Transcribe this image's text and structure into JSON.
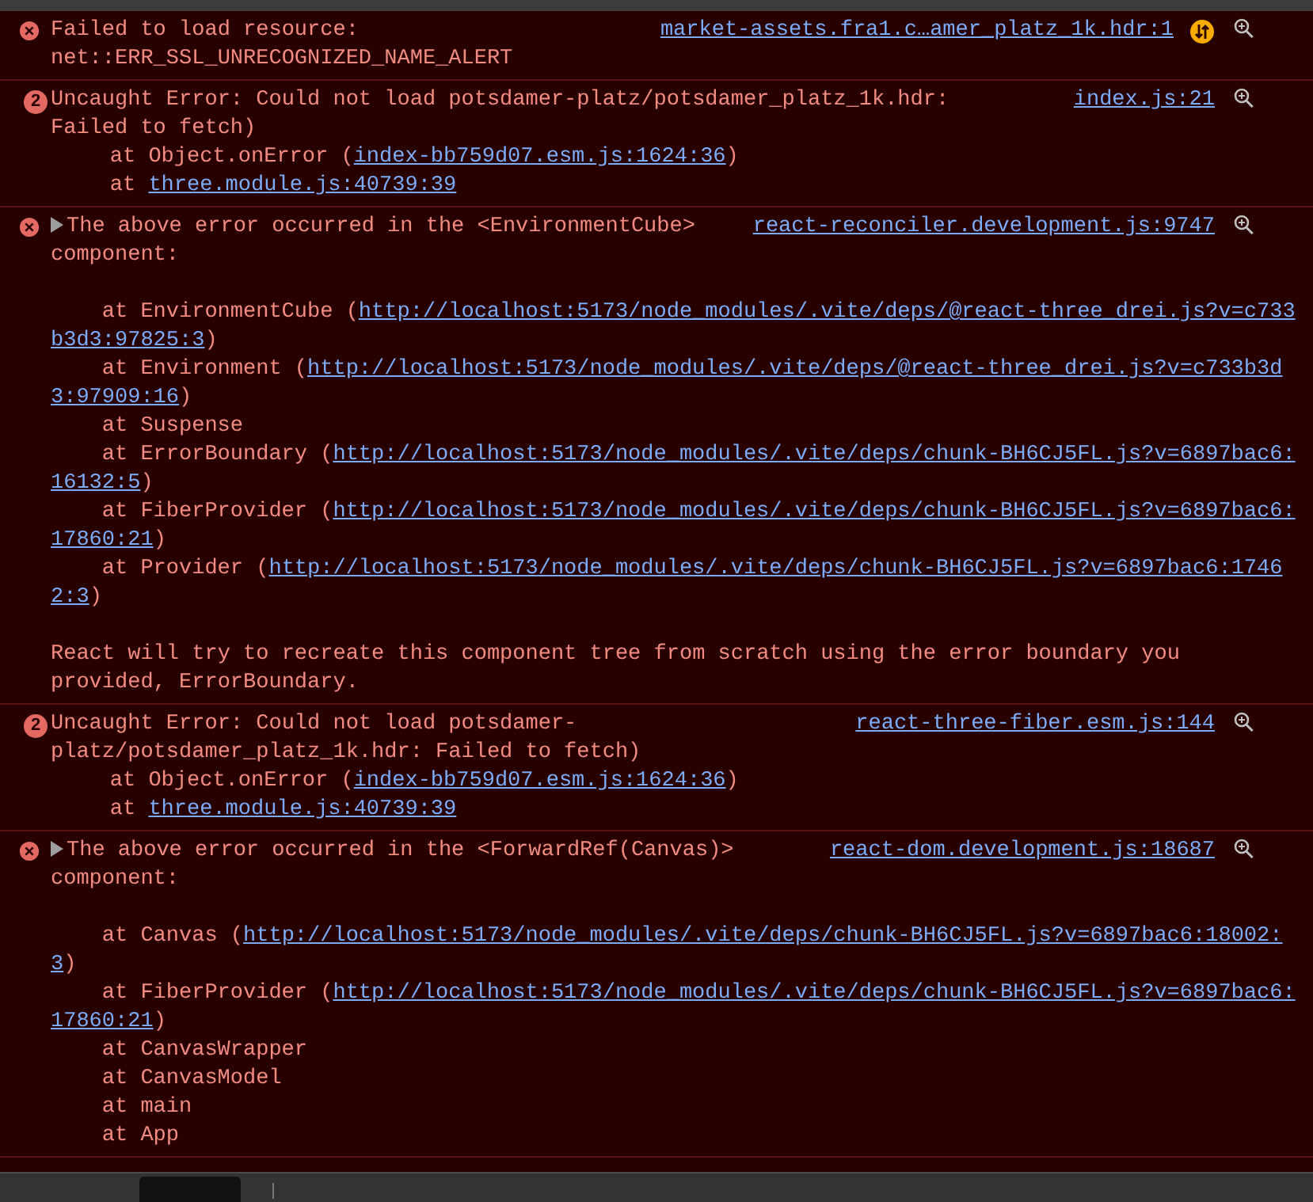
{
  "messages": [
    {
      "icon": {
        "kind": "error"
      },
      "override_icon": true,
      "head": [
        "Failed to load resource:",
        "net::ERR_SSL_UNRECOGNIZED_NAME_ALERT"
      ],
      "source": "market-assets.fra1.c…amer_platz_1k.hdr:1"
    },
    {
      "icon": {
        "kind": "count",
        "count": "2"
      },
      "override_icon": false,
      "head": [
        "Uncaught Error: Could not load potsdamer-platz/potsdamer_platz_1k.hdr:",
        "Failed to fetch)"
      ],
      "source": "index.js:21",
      "body": [
        {
          "kind": "frame",
          "text": "at Object.onError (",
          "url": "index-bb759d07.esm.js:1624:36",
          "suffix": ")"
        },
        {
          "kind": "frame",
          "text": "at ",
          "url": "three.module.js:40739:39"
        }
      ]
    },
    {
      "icon": {
        "kind": "error"
      },
      "override_icon": false,
      "expander": {
        "expanded": false
      },
      "head": [
        "The above error occurred in the <EnvironmentCube>",
        "component:"
      ],
      "source": "react-reconciler.development.js:9747",
      "body": [
        {
          "kind": "gap"
        },
        {
          "kind": "frame",
          "text": "at EnvironmentCube (",
          "url": "http://localhost:5173/node_modules/.vite/deps/@react-three_drei.js?v=c733b3d3:97825:3",
          "suffix": ")"
        },
        {
          "kind": "frame",
          "text": "at Environment (",
          "url": "http://localhost:5173/node_modules/.vite/deps/@react-three_drei.js?v=c733b3d3:97909:16",
          "suffix": ")"
        },
        {
          "kind": "frame",
          "text": "at Suspense"
        },
        {
          "kind": "frame",
          "text": "at ErrorBoundary (",
          "url": "http://localhost:5173/node_modules/.vite/deps/chunk-BH6CJ5FL.js?v=6897bac6:16132:5",
          "suffix": ")"
        },
        {
          "kind": "frame",
          "text": "at FiberProvider (",
          "url": "http://localhost:5173/node_modules/.vite/deps/chunk-BH6CJ5FL.js?v=6897bac6:17860:21",
          "suffix": ")"
        },
        {
          "kind": "frame",
          "text": "at Provider (",
          "url": "http://localhost:5173/node_modules/.vite/deps/chunk-BH6CJ5FL.js?v=6897bac6:17462:3",
          "suffix": ")"
        },
        {
          "kind": "gap"
        },
        {
          "kind": "text",
          "text": "React will try to recreate this component tree from scratch using the error boundary you provided, ErrorBoundary."
        }
      ]
    },
    {
      "icon": {
        "kind": "count",
        "count": "2"
      },
      "override_icon": false,
      "head": [
        "Uncaught Error: Could not load potsdamer-",
        "platz/potsdamer_platz_1k.hdr: Failed to fetch)"
      ],
      "source": "react-three-fiber.esm.js:144",
      "body": [
        {
          "kind": "frame",
          "text": "at Object.onError (",
          "url": "index-bb759d07.esm.js:1624:36",
          "suffix": ")"
        },
        {
          "kind": "frame",
          "text": "at ",
          "url": "three.module.js:40739:39"
        }
      ]
    },
    {
      "icon": {
        "kind": "error"
      },
      "override_icon": false,
      "expander": {
        "expanded": false
      },
      "head": [
        "The above error occurred in the <ForwardRef(Canvas)>",
        "component:"
      ],
      "source": "react-dom.development.js:18687",
      "body": [
        {
          "kind": "gap"
        },
        {
          "kind": "frame",
          "text": "at Canvas (",
          "url": "http://localhost:5173/node_modules/.vite/deps/chunk-BH6CJ5FL.js?v=6897bac6:18002:3",
          "suffix": ")"
        },
        {
          "kind": "frame",
          "text": "at FiberProvider (",
          "url": "http://localhost:5173/node_modules/.vite/deps/chunk-BH6CJ5FL.js?v=6897bac6:17860:21",
          "suffix": ")"
        },
        {
          "kind": "frame",
          "text": "at CanvasWrapper"
        },
        {
          "kind": "frame",
          "text": "at CanvasModel"
        },
        {
          "kind": "frame",
          "text": "at main"
        },
        {
          "kind": "frame",
          "text": "at App"
        }
      ]
    }
  ]
}
